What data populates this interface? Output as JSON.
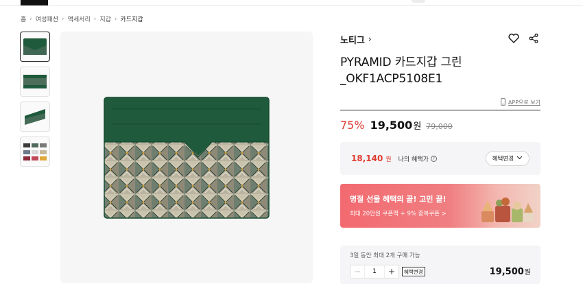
{
  "breadcrumb": [
    "홈",
    "여성패션",
    "액세서리",
    "지갑",
    "카드지갑"
  ],
  "product": {
    "brand": "노티그",
    "title": "PYRAMID 카드지갑 그린 _OKF1ACP5108E1"
  },
  "app_link": "APP으로 보기",
  "pricing": {
    "discount": "75%",
    "price": "19,500",
    "won": "원",
    "original": "79,000"
  },
  "benefit": {
    "price": "18,140",
    "won": "원",
    "label": "나의 혜택가",
    "button": "혜택변경"
  },
  "banner": {
    "title": "명절 선물 혜택의 끝! 고민 끝!",
    "subtitle": "최대 20만원 쿠폰팩 + 9% 중복쿠폰 >"
  },
  "order": {
    "note": "3일 동안 최대 2개 구매 가능",
    "quantity": "1",
    "option_button": "혜택변경",
    "total": "19,500",
    "won": "원"
  },
  "colors": {
    "accent_red": "#e03c31",
    "wallet_green": "#1f5a3c",
    "banner_pink": "#f26a70"
  },
  "icons": [
    "heart-icon",
    "share-icon",
    "phone-icon",
    "info-icon",
    "chevron-down-icon",
    "minus-icon",
    "plus-icon"
  ]
}
